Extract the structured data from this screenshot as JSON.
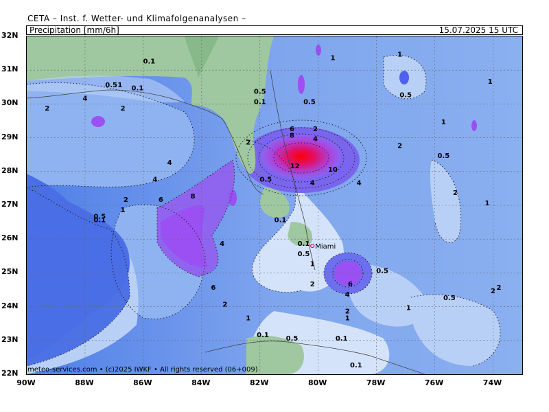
{
  "header": {
    "title": "CETA – Inst. f. Wetter- und Klimafolgenanalysen –"
  },
  "label_bar": {
    "left": "Precipitation  [mm/6h]",
    "right": "15.07.2025  15 UTC"
  },
  "footer": {
    "text": "meteo-services.com • (c)2025 IWKF • All rights reserved (06+009)"
  },
  "axes": {
    "lat": [
      "32N",
      "31N",
      "30N",
      "29N",
      "28N",
      "27N",
      "26N",
      "25N",
      "24N",
      "23N",
      "22N"
    ],
    "lon": [
      "90W",
      "88W",
      "86W",
      "84W",
      "82W",
      "80W",
      "78W",
      "76W",
      "74W"
    ]
  },
  "places": {
    "city": "Miami"
  },
  "contour_labels": [
    {
      "value": "0.1",
      "lon": -85.8,
      "lat": 31.2
    },
    {
      "value": "0.5",
      "lon": -87.1,
      "lat": 30.5
    },
    {
      "value": "0.1",
      "lon": -86.2,
      "lat": 30.4
    },
    {
      "value": "0.5",
      "lon": -82.0,
      "lat": 30.3
    },
    {
      "value": "0.1",
      "lon": -82.0,
      "lat": 30.0
    },
    {
      "value": "0.5",
      "lon": -80.3,
      "lat": 30.0
    },
    {
      "value": "1",
      "lon": -79.5,
      "lat": 31.3
    },
    {
      "value": "1",
      "lon": -77.2,
      "lat": 31.4
    },
    {
      "value": "0.5",
      "lon": -77.0,
      "lat": 30.2
    },
    {
      "value": "1",
      "lon": -74.1,
      "lat": 30.6
    },
    {
      "value": "2",
      "lon": -89.3,
      "lat": 29.8
    },
    {
      "value": "4",
      "lon": -88.0,
      "lat": 30.1
    },
    {
      "value": "1",
      "lon": -86.8,
      "lat": 30.5
    },
    {
      "value": "2",
      "lon": -86.7,
      "lat": 29.8
    },
    {
      "value": "6",
      "lon": -80.9,
      "lat": 29.2
    },
    {
      "value": "8",
      "lon": -80.9,
      "lat": 29.0
    },
    {
      "value": "2",
      "lon": -80.1,
      "lat": 29.2
    },
    {
      "value": "4",
      "lon": -80.1,
      "lat": 28.9
    },
    {
      "value": "12",
      "lon": -80.8,
      "lat": 28.1
    },
    {
      "value": "10",
      "lon": -79.5,
      "lat": 28.0
    },
    {
      "value": "1",
      "lon": -75.7,
      "lat": 29.4
    },
    {
      "value": "2",
      "lon": -77.2,
      "lat": 28.7
    },
    {
      "value": "0.5",
      "lon": -75.7,
      "lat": 28.4
    },
    {
      "value": "2",
      "lon": -82.4,
      "lat": 28.8
    },
    {
      "value": "4",
      "lon": -85.1,
      "lat": 28.2
    },
    {
      "value": "4",
      "lon": -85.6,
      "lat": 27.7
    },
    {
      "value": "0.5",
      "lon": -81.8,
      "lat": 27.7
    },
    {
      "value": "4",
      "lon": -80.2,
      "lat": 27.6
    },
    {
      "value": "4",
      "lon": -78.6,
      "lat": 27.6
    },
    {
      "value": "2",
      "lon": -75.3,
      "lat": 27.3
    },
    {
      "value": "1",
      "lon": -74.2,
      "lat": 27.0
    },
    {
      "value": "6",
      "lon": -85.4,
      "lat": 27.1
    },
    {
      "value": "8",
      "lon": -84.3,
      "lat": 27.2
    },
    {
      "value": "2",
      "lon": -86.6,
      "lat": 27.1
    },
    {
      "value": "1",
      "lon": -86.7,
      "lat": 26.8
    },
    {
      "value": "0.5",
      "lon": -87.5,
      "lat": 26.6
    },
    {
      "value": "0.1",
      "lon": -87.5,
      "lat": 26.5
    },
    {
      "value": "0.1",
      "lon": -81.3,
      "lat": 26.5
    },
    {
      "value": "0.1",
      "lon": -80.5,
      "lat": 25.8
    },
    {
      "value": "0.5",
      "lon": -80.5,
      "lat": 25.5
    },
    {
      "value": "4",
      "lon": -83.3,
      "lat": 25.8
    },
    {
      "value": "1",
      "lon": -80.2,
      "lat": 25.2
    },
    {
      "value": "0.5",
      "lon": -77.8,
      "lat": 25.0
    },
    {
      "value": "6",
      "lon": -83.6,
      "lat": 24.5
    },
    {
      "value": "2",
      "lon": -80.2,
      "lat": 24.6
    },
    {
      "value": "6",
      "lon": -78.9,
      "lat": 24.6
    },
    {
      "value": "4",
      "lon": -79.0,
      "lat": 24.3
    },
    {
      "value": "0.5",
      "lon": -75.5,
      "lat": 24.2
    },
    {
      "value": "2",
      "lon": -73.8,
      "lat": 24.5
    },
    {
      "value": "2",
      "lon": -74.0,
      "lat": 24.4
    },
    {
      "value": "2",
      "lon": -83.2,
      "lat": 24.0
    },
    {
      "value": "1",
      "lon": -76.9,
      "lat": 23.9
    },
    {
      "value": "2",
      "lon": -79.0,
      "lat": 23.8
    },
    {
      "value": "1",
      "lon": -79.0,
      "lat": 23.6
    },
    {
      "value": "1",
      "lon": -82.4,
      "lat": 23.6
    },
    {
      "value": "0.1",
      "lon": -81.9,
      "lat": 23.1
    },
    {
      "value": "0.5",
      "lon": -80.9,
      "lat": 23.0
    },
    {
      "value": "0.1",
      "lon": -79.2,
      "lat": 23.0
    },
    {
      "value": "0.1",
      "lon": -78.7,
      "lat": 22.2
    }
  ]
}
